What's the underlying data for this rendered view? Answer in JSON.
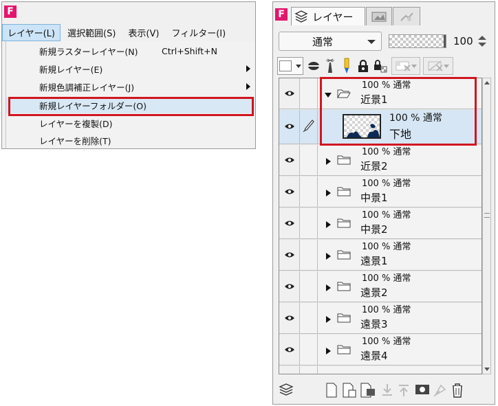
{
  "menu_window": {
    "app_badge": "F",
    "menubar": [
      {
        "label": "レイヤー(L)",
        "active": true
      },
      {
        "label": "選択範囲(S)",
        "active": false
      },
      {
        "label": "表示(V)",
        "active": false
      },
      {
        "label": "フィルター(I)",
        "active": false
      }
    ],
    "dropdown": [
      {
        "label": "新規ラスターレイヤー(N)",
        "shortcut": "Ctrl+Shift+N",
        "submenu": false,
        "highlighted": false
      },
      {
        "label": "新規レイヤー(E)",
        "shortcut": "",
        "submenu": true,
        "highlighted": false
      },
      {
        "label": "新規色調補正レイヤー(J)",
        "shortcut": "",
        "submenu": true,
        "highlighted": false
      },
      {
        "label": "新規レイヤーフォルダー(O)",
        "shortcut": "",
        "submenu": false,
        "highlighted": true
      },
      {
        "label": "レイヤーを複製(D)",
        "shortcut": "",
        "submenu": false,
        "highlighted": false
      },
      {
        "label": "レイヤーを削除(T)",
        "shortcut": "",
        "submenu": false,
        "highlighted": false
      }
    ]
  },
  "layer_panel": {
    "app_badge": "F",
    "tabs": [
      {
        "label": "レイヤー",
        "icon": "layers-icon",
        "active": true
      },
      {
        "label": "",
        "icon": "navigator-icon",
        "active": false
      },
      {
        "label": "",
        "icon": "sub-view-icon",
        "active": false
      }
    ],
    "blend_mode": "通常",
    "opacity": "100",
    "opacity_fraction": 1.0,
    "layers": [
      {
        "meta": "100 % 通常",
        "name": "近景1",
        "kind": "folder",
        "expanded": true,
        "indent": 0,
        "selected": false
      },
      {
        "meta": "100 % 通常",
        "name": "下地",
        "kind": "raster",
        "expanded": false,
        "indent": 1,
        "selected": true
      },
      {
        "meta": "100 % 通常",
        "name": "近景2",
        "kind": "folder",
        "expanded": false,
        "indent": 0,
        "selected": false
      },
      {
        "meta": "100 % 通常",
        "name": "中景1",
        "kind": "folder",
        "expanded": false,
        "indent": 0,
        "selected": false
      },
      {
        "meta": "100 % 通常",
        "name": "中景2",
        "kind": "folder",
        "expanded": false,
        "indent": 0,
        "selected": false
      },
      {
        "meta": "100 % 通常",
        "name": "遠景1",
        "kind": "folder",
        "expanded": false,
        "indent": 0,
        "selected": false
      },
      {
        "meta": "100 % 通常",
        "name": "遠景2",
        "kind": "folder",
        "expanded": false,
        "indent": 0,
        "selected": false
      },
      {
        "meta": "100 % 通常",
        "name": "遠景3",
        "kind": "folder",
        "expanded": false,
        "indent": 0,
        "selected": false
      },
      {
        "meta": "100 % 通常",
        "name": "遠景4",
        "kind": "folder",
        "expanded": false,
        "indent": 0,
        "selected": false
      }
    ]
  },
  "colors": {
    "badge": "#e3166d",
    "highlight_box": "#d1151f",
    "selection": "#d6e6f4"
  }
}
